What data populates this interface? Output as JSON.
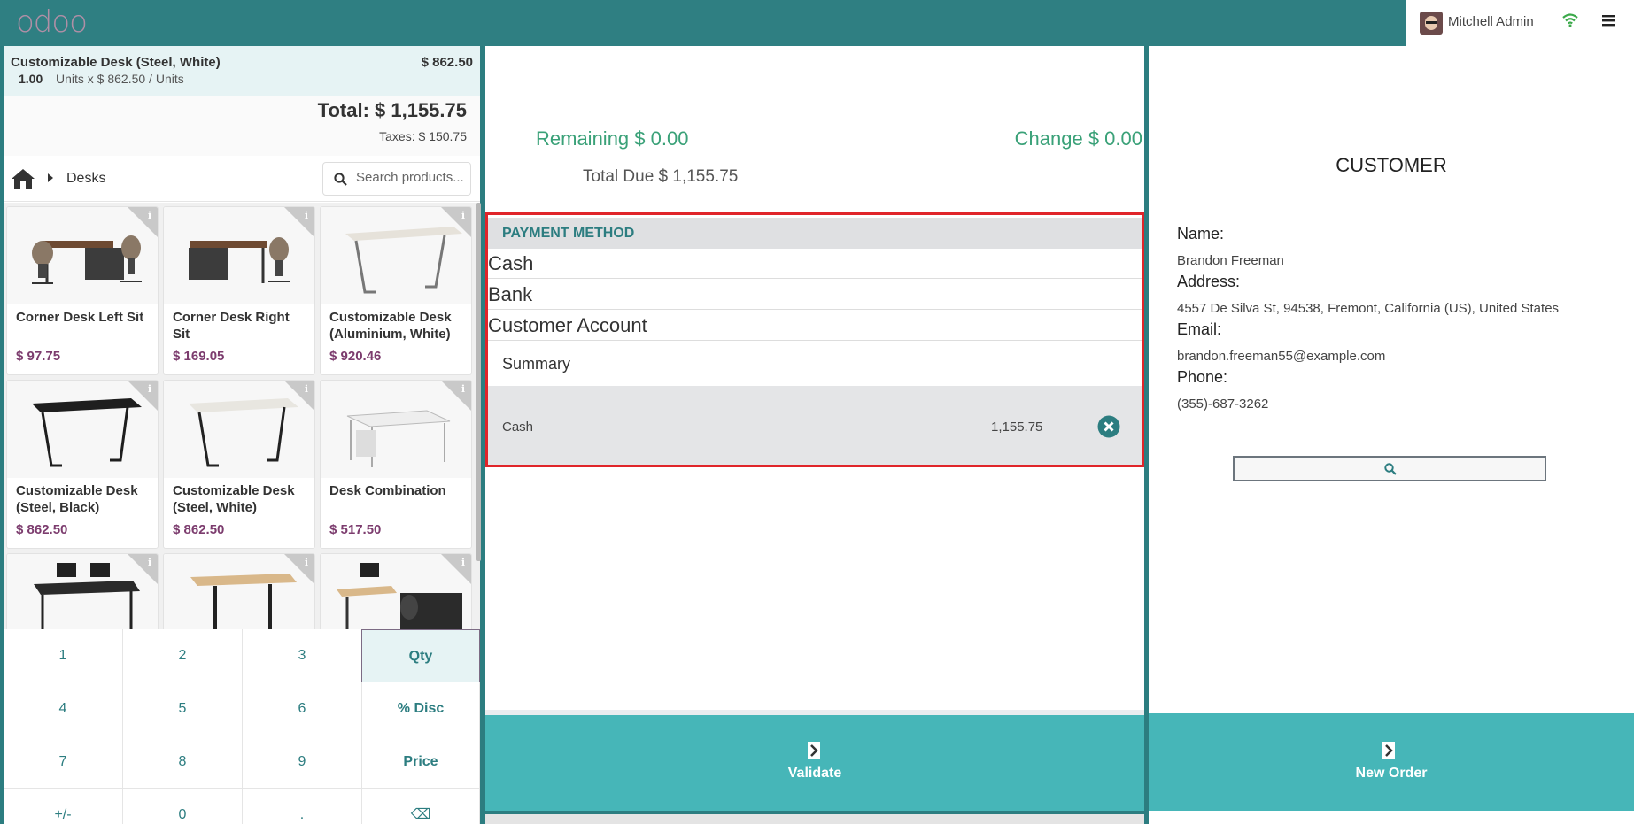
{
  "header": {
    "logo_text": "odoo",
    "user_name": "Mitchell Admin"
  },
  "order": {
    "line": {
      "product": "Customizable Desk (Steel, White)",
      "price": "$ 862.50",
      "qty": "1.00",
      "unit_info": "Units x $ 862.50 / Units"
    },
    "total": "Total: $ 1,155.75",
    "taxes": "Taxes: $ 150.75"
  },
  "breadcrumb": {
    "category": "Desks"
  },
  "search": {
    "placeholder": "Search products..."
  },
  "products": [
    {
      "name": "Corner Desk Left Sit",
      "price": "$ 97.75"
    },
    {
      "name": "Corner Desk Right Sit",
      "price": "$ 169.05"
    },
    {
      "name": "Customizable Desk (Aluminium, White)",
      "price": "$ 920.46"
    },
    {
      "name": "Customizable Desk (Steel, Black)",
      "price": "$ 862.50"
    },
    {
      "name": "Customizable Desk (Steel, White)",
      "price": "$ 862.50"
    },
    {
      "name": "Desk Combination",
      "price": "$ 517.50"
    },
    {
      "name": "",
      "price": ""
    },
    {
      "name": "",
      "price": ""
    },
    {
      "name": "",
      "price": ""
    }
  ],
  "numpad": {
    "keys": [
      "1",
      "2",
      "3",
      "Qty",
      "4",
      "5",
      "6",
      "% Disc",
      "7",
      "8",
      "9",
      "Price",
      "+/-",
      "0",
      ".",
      "⌫"
    ]
  },
  "payment": {
    "remaining": "Remaining $ 0.00",
    "change": "Change $ 0.00",
    "total_due": "Total Due $ 1,155.75",
    "methods_header": "PAYMENT METHOD",
    "methods": [
      "Cash",
      "Bank",
      "Customer Account"
    ],
    "summary_title": "Summary",
    "summary_line": {
      "method": "Cash",
      "amount": "1,155.75"
    },
    "validate_label": "Validate"
  },
  "customer": {
    "title": "CUSTOMER",
    "name_label": "Name:",
    "name": "Brandon Freeman",
    "address_label": "Address:",
    "address": "4557 De Silva St, 94538, Fremont, California (US), United States",
    "email_label": "Email:",
    "email": "brandon.freeman55@example.com",
    "phone_label": "Phone:",
    "phone": "(355)-687-3262",
    "new_order_label": "New Order"
  },
  "colors": {
    "brand_teal": "#2c7d80",
    "button_teal": "#46b6b8",
    "price_purple": "#7c3c6e",
    "amount_green": "#3aa178",
    "highlight_red": "#e0252a"
  }
}
